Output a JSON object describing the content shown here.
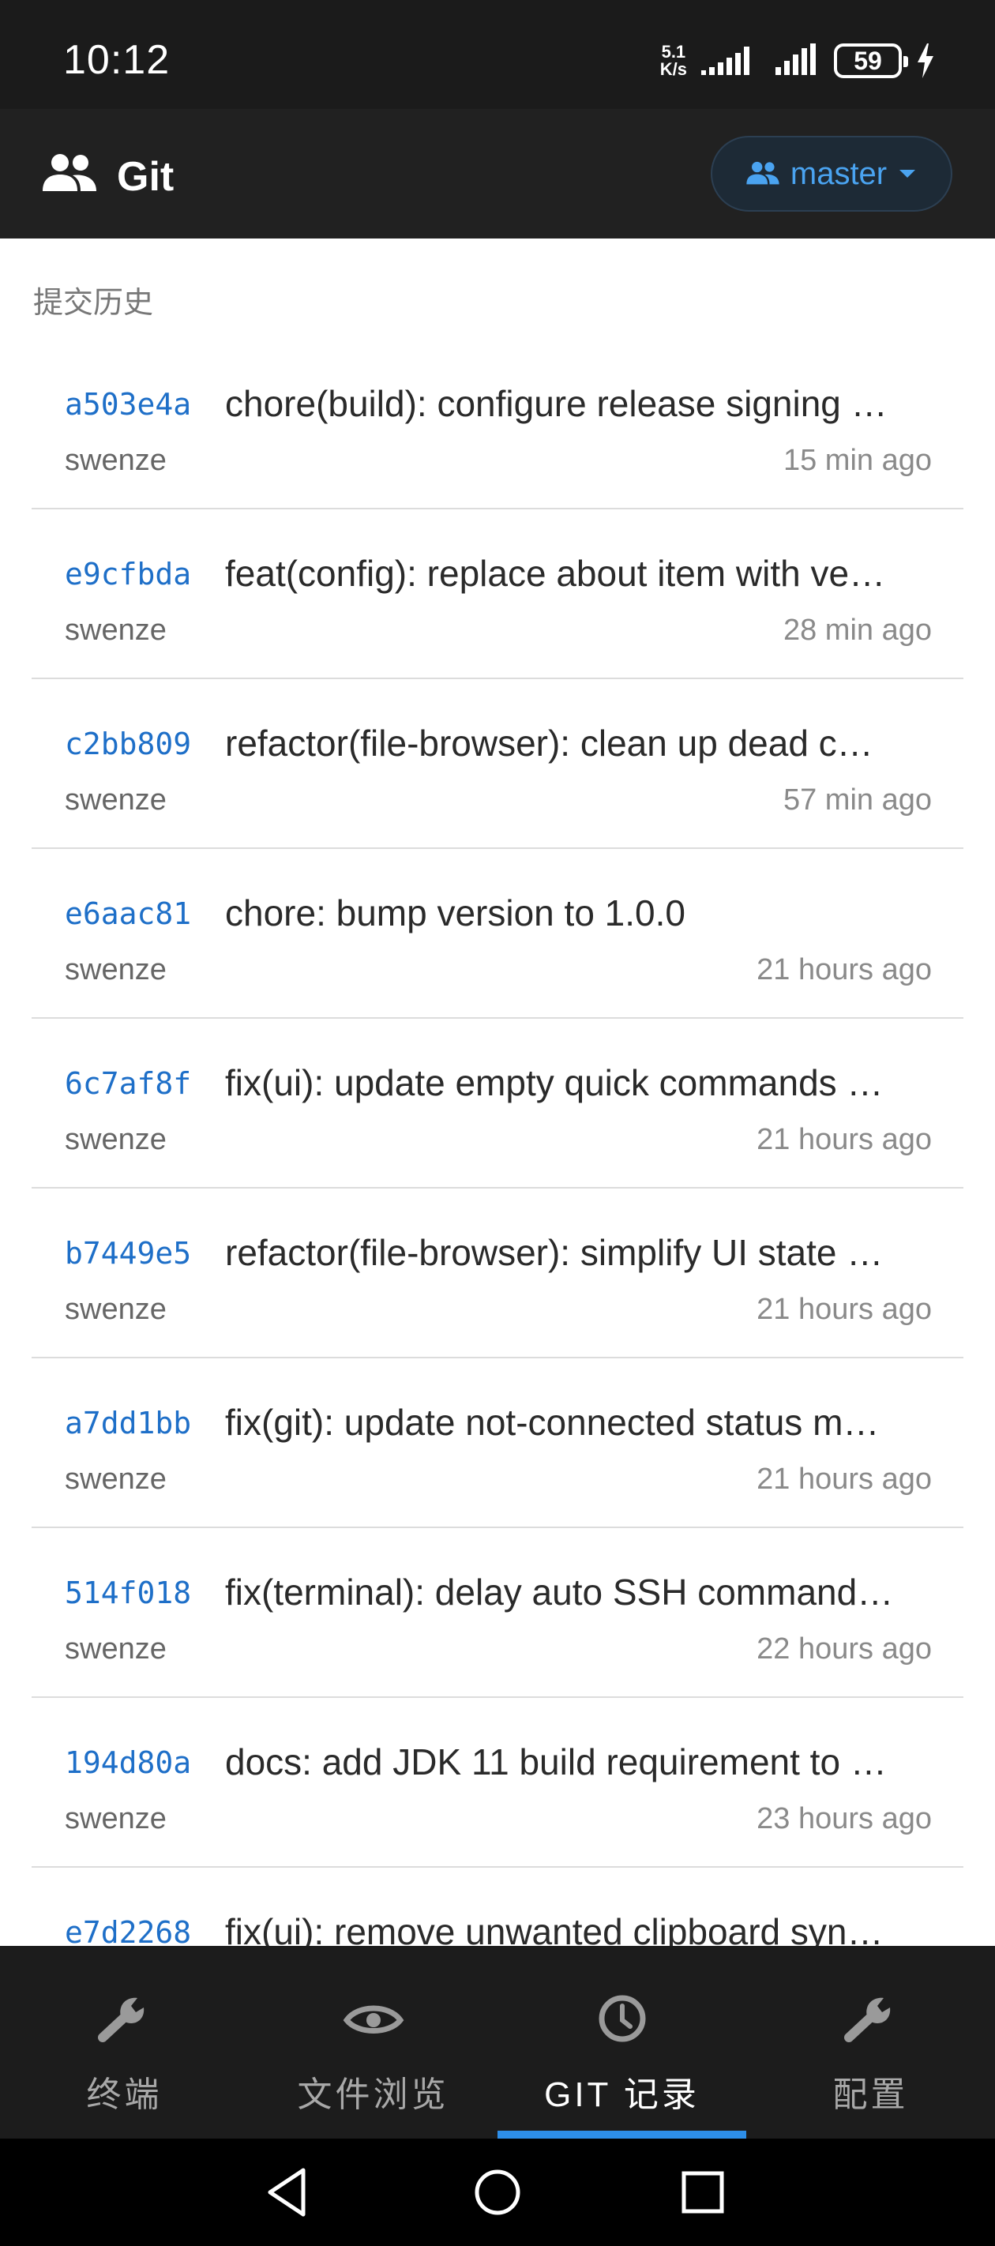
{
  "status_bar": {
    "time": "10:12",
    "net_speed_value": "5.1",
    "net_speed_unit": "K/s",
    "battery": "59"
  },
  "app_bar": {
    "title": "Git",
    "branch": "master"
  },
  "history": {
    "section_title": "提交历史",
    "commits": [
      {
        "hash": "a503e4a",
        "message": "chore(build): configure release signing …",
        "author": "swenze",
        "time": "15 min ago"
      },
      {
        "hash": "e9cfbda",
        "message": "feat(config): replace about item with ve…",
        "author": "swenze",
        "time": "28 min ago"
      },
      {
        "hash": "c2bb809",
        "message": "refactor(file-browser): clean up dead c…",
        "author": "swenze",
        "time": "57 min ago"
      },
      {
        "hash": "e6aac81",
        "message": "chore: bump version to 1.0.0",
        "author": "swenze",
        "time": "21 hours ago"
      },
      {
        "hash": "6c7af8f",
        "message": "fix(ui): update empty quick commands …",
        "author": "swenze",
        "time": "21 hours ago"
      },
      {
        "hash": "b7449e5",
        "message": "refactor(file-browser): simplify UI state …",
        "author": "swenze",
        "time": "21 hours ago"
      },
      {
        "hash": "a7dd1bb",
        "message": "fix(git): update not-connected status m…",
        "author": "swenze",
        "time": "21 hours ago"
      },
      {
        "hash": "514f018",
        "message": "fix(terminal): delay auto SSH command…",
        "author": "swenze",
        "time": "22 hours ago"
      },
      {
        "hash": "194d80a",
        "message": "docs: add JDK 11 build requirement to …",
        "author": "swenze",
        "time": "23 hours ago"
      },
      {
        "hash": "e7d2268",
        "message": "fix(ui): remove unwanted clipboard syn…",
        "author": "",
        "time": ""
      }
    ]
  },
  "bottom_nav": {
    "items": [
      {
        "label": "终端",
        "icon": "wrench-icon"
      },
      {
        "label": "文件浏览",
        "icon": "eye-icon"
      },
      {
        "label": "GIT 记录",
        "icon": "clock-icon"
      },
      {
        "label": "配置",
        "icon": "wrench-icon"
      }
    ],
    "active_index": 2
  },
  "colors": {
    "accent": "#2d8ee8",
    "hash": "#1e6fc8",
    "app_bar": "#212121",
    "nav_bar": "#1c1c1c"
  }
}
